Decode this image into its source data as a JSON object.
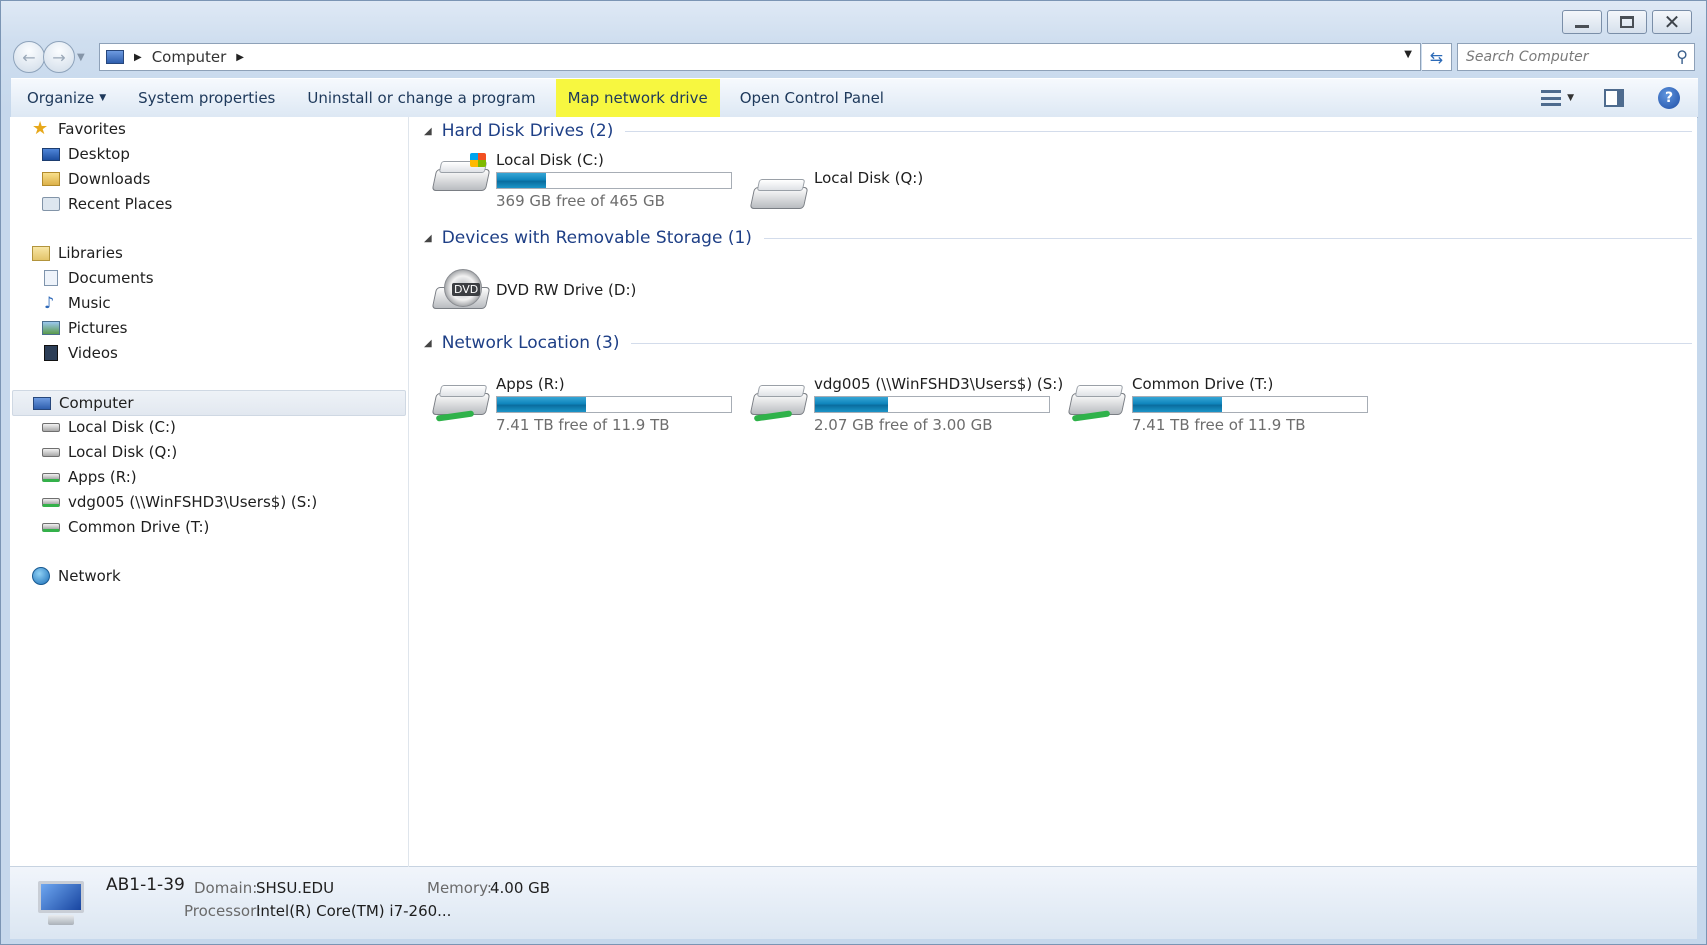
{
  "window": {
    "minimize_icon": "minimize-icon",
    "maximize_icon": "maximize-icon",
    "close_icon": "close-icon"
  },
  "address": {
    "crumb": "Computer",
    "search_placeholder": "Search Computer"
  },
  "toolbar": {
    "organize": "Organize",
    "system_properties": "System properties",
    "uninstall": "Uninstall or change a program",
    "map_network_drive": "Map network drive",
    "open_control_panel": "Open Control Panel",
    "highlight_color": "#f7f740"
  },
  "sidebar": {
    "favorites": "Favorites",
    "desktop": "Desktop",
    "downloads": "Downloads",
    "recent_places": "Recent Places",
    "libraries": "Libraries",
    "documents": "Documents",
    "music": "Music",
    "pictures": "Pictures",
    "videos": "Videos",
    "computer": "Computer",
    "local_c": "Local Disk (C:)",
    "local_q": "Local Disk (Q:)",
    "apps_r": "Apps (R:)",
    "vdg_s": "vdg005 (\\\\WinFSHD3\\Users$) (S:)",
    "common_t": "Common Drive (T:)",
    "network": "Network"
  },
  "groups": {
    "hdd": "Hard Disk Drives (2)",
    "removable": "Devices with Removable Storage (1)",
    "network": "Network Location (3)"
  },
  "drives": {
    "c": {
      "name": "Local Disk (C:)",
      "free": "369 GB free of 465 GB",
      "used_fraction": 0.21
    },
    "q": {
      "name": "Local Disk (Q:)"
    },
    "d": {
      "name": "DVD RW Drive (D:)",
      "badge": "DVD"
    },
    "r": {
      "name": "Apps (R:)",
      "free": "7.41 TB free of 11.9 TB",
      "used_fraction": 0.38
    },
    "s": {
      "name": "vdg005 (\\\\WinFSHD3\\Users$) (S:)",
      "free": "2.07 GB free of 3.00 GB",
      "used_fraction": 0.31
    },
    "t": {
      "name": "Common Drive (T:)",
      "free": "7.41 TB free of 11.9 TB",
      "used_fraction": 0.38
    }
  },
  "details": {
    "computer_name": "AB1-1-39",
    "domain_label": "Domain:",
    "domain_value": "SHSU.EDU",
    "memory_label": "Memory:",
    "memory_value": "4.00 GB",
    "processor_label": "Processor:",
    "processor_value": "Intel(R) Core(TM) i7-260..."
  }
}
